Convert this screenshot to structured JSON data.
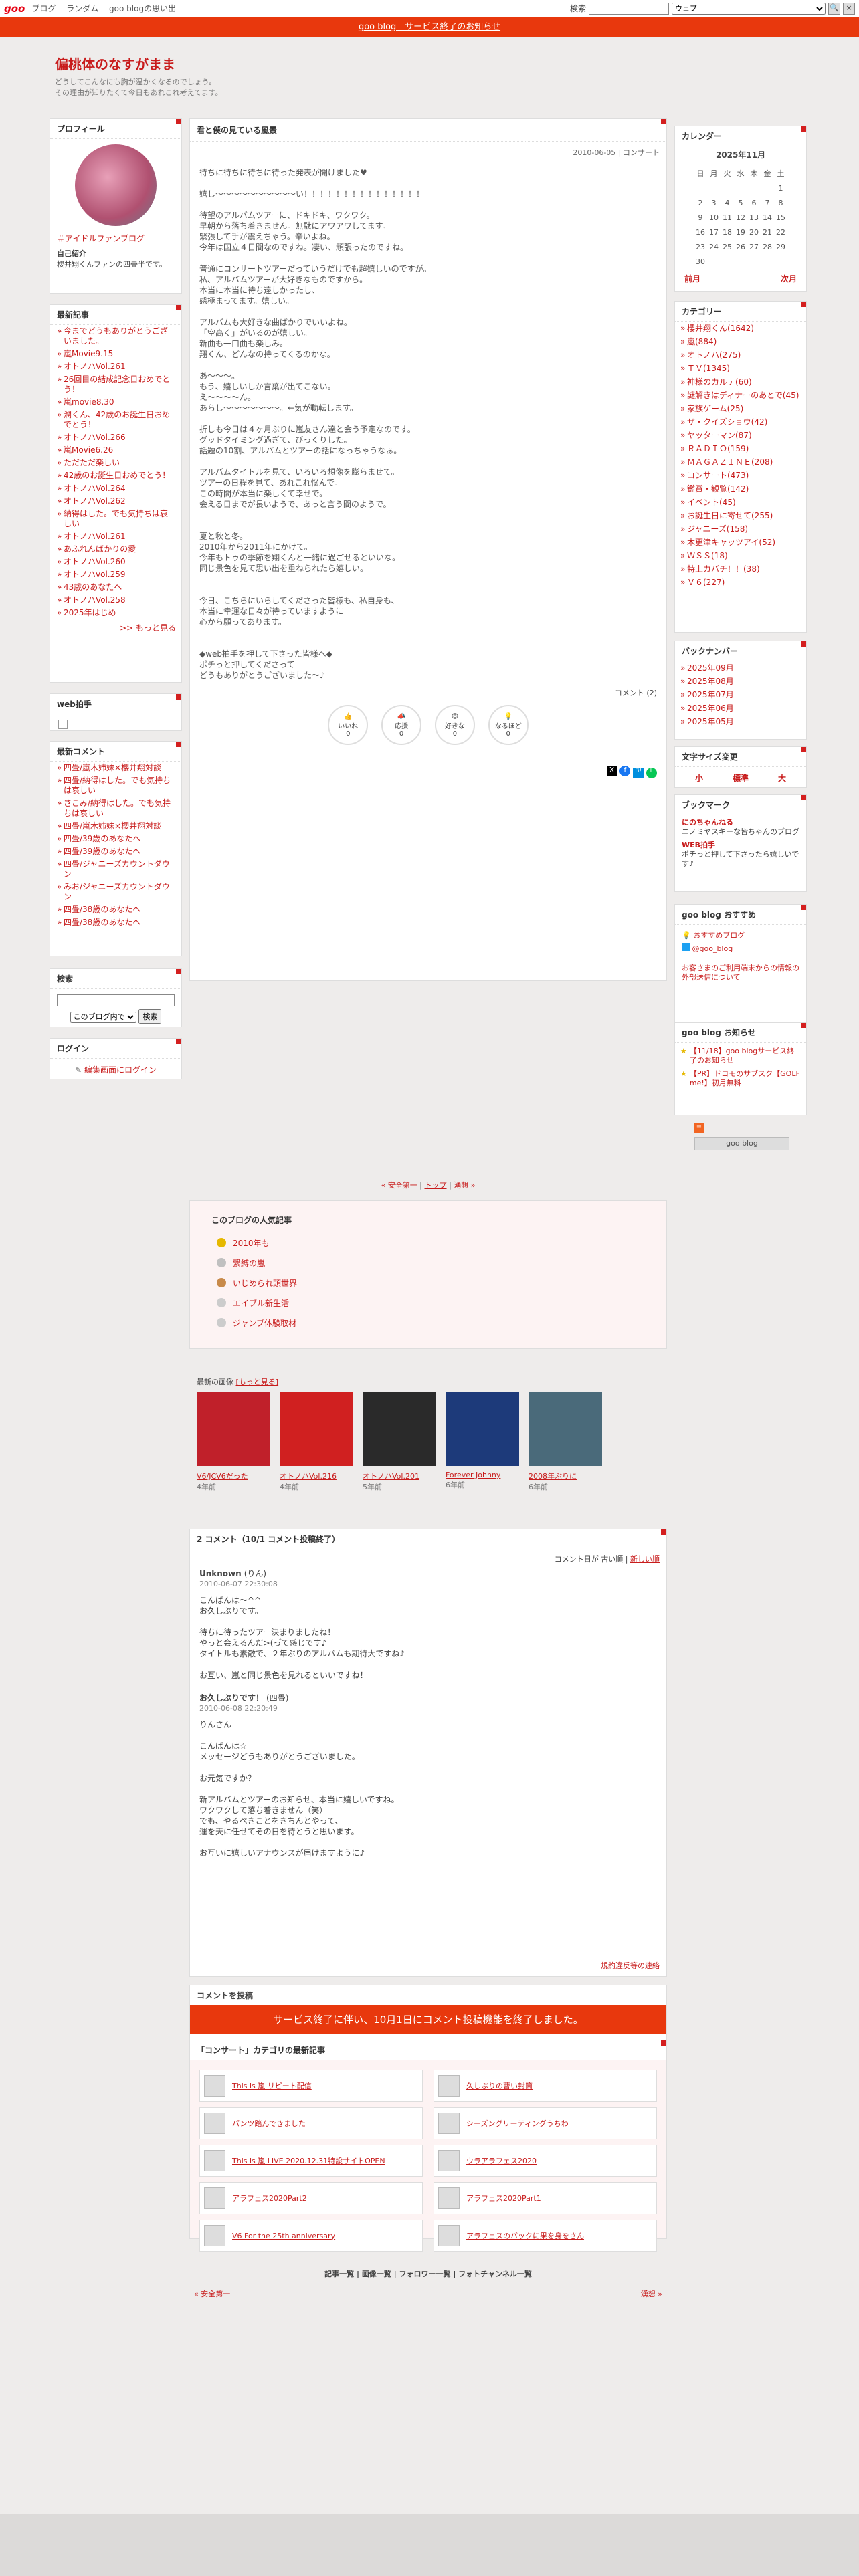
{
  "topbar": {
    "logo": "goo",
    "links": [
      "ブログ",
      "ランダム",
      "goo blogの思い出"
    ],
    "search_label": "検索",
    "search_scope": "ウェブ"
  },
  "banner": "goo blog　サービス終了のお知らせ",
  "header": {
    "title": "偏桃体のなすがまま",
    "desc1": "どうしてこんなにも胸が温かくなるのでしょう。",
    "desc2": "その理由が知りたくて今日もあれこれ考えてます。"
  },
  "profile": {
    "title": "プロフィール",
    "name": "＃アイドルファンブログ",
    "intro_label": "自己紹介",
    "intro": "櫻井翔くんファンの四畳半です。"
  },
  "recent": {
    "title": "最新記事",
    "items": [
      "今までどうもありがとうございました。",
      "嵐Movie9.15",
      "オトノハVol.261",
      "26回目の結成記念日おめでとう！",
      "嵐movie8.30",
      "潤くん、42歳のお誕生日おめでとう！",
      "オトノハVol.266",
      "嵐Movie6.26",
      "ただただ楽しい",
      "42歳のお誕生日おめでとう！",
      "オトノハVol.264",
      "オトノハVol.262",
      "納得はした。でも気持ちは哀しい",
      "オトノハVol.261",
      "あふれんばかりの愛",
      "オトノハVol.260",
      "オトノハvol.259",
      "43歳のあなたへ",
      "オトノハVol.258",
      "2025年はじめ"
    ],
    "more": ">> もっと見る"
  },
  "webclap": {
    "title": "web拍手"
  },
  "comments": {
    "title": "最新コメント",
    "items": [
      "四畳/嵐木姉妹×櫻井翔対談",
      "四畳/納得はした。でも気持ちは哀しい",
      "さこみ/納得はした。でも気持ちは哀しい",
      "四畳/嵐木姉妹×櫻井翔対談",
      "四畳/39歳のあなたへ",
      "四畳/39歳のあなたへ",
      "四畳/ジャニーズカウントダウン",
      "みお/ジャニーズカウントダウン",
      "四畳/38歳のあなたへ",
      "四畳/38歳のあなたへ"
    ]
  },
  "search": {
    "title": "検索",
    "scope": "このブログ内で",
    "button": "検索"
  },
  "login": {
    "title": "ログイン",
    "link": "編集画面にログイン"
  },
  "post": {
    "title": "君と僕の見ている風景",
    "meta": "2010-06-05 | コンサート",
    "body": [
      "待ちに待ちに待ちに待った発表が開けました♥",
      "",
      "嬉し〜〜〜〜〜〜〜〜〜〜い！！！！！！！！！！！！！！！",
      "",
      "待望のアルバムツアーに、ドキドキ、ワクワク。",
      "早朝から落ち着きません。無駄にアワアワしてます。",
      "緊張して手が震えちゃう。辛いよね。",
      "今年は国立４日間なのですね。凄い、頑張ったのですね。",
      "",
      "普通にコンサートツアーだっていうだけでも超嬉しいのですが。",
      "私、アルバムツアーが大好きなものですから。",
      "本当に本当に待ち遠しかったし、",
      "感極まってます。嬉しい。",
      "",
      "アルバムも大好きな曲ばかりでいいよね。",
      "「空高く」がいるのが嬉しい。",
      "新曲も一口曲も楽しみ。",
      "翔くん、どんなの持ってくるのかな。",
      "",
      "あ〜〜〜。",
      "もう、嬉しいしか言葉が出てこない。",
      "え〜〜〜〜ん。",
      "あらし〜〜〜〜〜〜〜。←気が動転します。",
      "",
      "折しも今日は４ヶ月ぶりに嵐友さん達と会う予定なのです。",
      "グッドタイミング過ぎて、びっくりした。",
      "話題の10割、アルバムとツアーの話になっちゃうなぁ。",
      "",
      "アルバムタイトルを見て、いろいろ想像を膨らませて。",
      "ツアーの日程を見て、あれこれ悩んで。",
      "この時間が本当に楽しくて幸せで。",
      "会える日までが長いようで、あっと言う間のようで。",
      "",
      "",
      "夏と秋と冬。",
      "2010年から2011年にかけて。",
      "今年もトゥの季節を翔くんと一緒に過ごせるといいな。",
      "同じ景色を見て思い出を重ねられたら嬉しい。",
      "",
      "",
      "今日、こちらにいらしてくださった皆様も、私自身も、",
      "本当に幸運な日々が待っていますように",
      "心から願ってあります。",
      "",
      "",
      "◆web拍手を押して下さった皆様へ◆",
      "ポチっと押してくださって",
      "どうもありがとうございました〜♪"
    ],
    "comment_count": "コメント (2)",
    "reactions": [
      {
        "label": "いいね",
        "count": "0"
      },
      {
        "label": "応援",
        "count": "0"
      },
      {
        "label": "好きな",
        "count": "0"
      },
      {
        "label": "なるほど",
        "count": "0"
      }
    ]
  },
  "calendar": {
    "title": "カレンダー",
    "month": "2025年11月",
    "days": [
      "日",
      "月",
      "火",
      "水",
      "木",
      "金",
      "土"
    ],
    "weeks": [
      [
        "",
        "",
        "",
        "",
        "",
        "",
        "1"
      ],
      [
        "2",
        "3",
        "4",
        "5",
        "6",
        "7",
        "8"
      ],
      [
        "9",
        "10",
        "11",
        "12",
        "13",
        "14",
        "15"
      ],
      [
        "16",
        "17",
        "18",
        "19",
        "20",
        "21",
        "22"
      ],
      [
        "23",
        "24",
        "25",
        "26",
        "27",
        "28",
        "29"
      ],
      [
        "30",
        "",
        "",
        "",
        "",
        "",
        ""
      ]
    ],
    "prev": "前月",
    "next": "次月"
  },
  "categories": {
    "title": "カテゴリー",
    "items": [
      "櫻井翔くん(1642)",
      "嵐(884)",
      "オトノハ(275)",
      "ＴＶ(1345)",
      "神様のカルテ(60)",
      "謎解きはディナーのあとで(45)",
      "家族ゲーム(25)",
      "ザ・クイズショウ(42)",
      "ヤッターマン(87)",
      "ＲＡＤＩＯ(159)",
      "ＭＡＧＡＺＩＮＥ(208)",
      "コンサート(473)",
      "鑑賞・観覧(142)",
      "イベント(45)",
      "お誕生日に寄せて(255)",
      "ジャニーズ(158)",
      "木更津キャッツアイ(52)",
      "ＷＳＳ(18)",
      "特上カバチ！！(38)",
      "Ｖ６(227)"
    ]
  },
  "backnumber": {
    "title": "バックナンバー",
    "items": [
      "2025年09月",
      "2025年08月",
      "2025年07月",
      "2025年06月",
      "2025年05月"
    ]
  },
  "fontsize": {
    "title": "文字サイズ変更",
    "small": "小",
    "mid": "標準",
    "large": "大"
  },
  "bookmark": {
    "title": "ブックマーク",
    "items": [
      {
        "name": "にのちゃんねる",
        "desc": "ニノミヤスキーな皆ちゃんのブログ"
      },
      {
        "name": "WEB拍手",
        "desc": "ポチっと押して下さったら嬉しいです♪"
      }
    ]
  },
  "recommend": {
    "title": "goo blog おすすめ",
    "items": [
      "おすすめブログ",
      "@goo_blog"
    ],
    "notice": "お客さまのご利用端末からの情報の外部送信について"
  },
  "announce": {
    "title": "goo blog お知らせ",
    "items": [
      "【11/18】goo blogサービス終了のお知らせ",
      "【PR】ドコモのサブスク【GOLF me!】初月無料"
    ]
  },
  "goo_blog_badge": "goo blog",
  "pager": {
    "prev": "« 安全第一",
    "top": "トップ",
    "next": "湧想 »"
  },
  "popular": {
    "title": "このブログの人気記事",
    "items": [
      "2010年も",
      "繋縛の嵐",
      "いじめられ頭世界一",
      "エイブル新生活",
      "ジャンプ体験取材"
    ]
  },
  "images": {
    "title": "最新の画像",
    "more": "[もっと見る]",
    "items": [
      {
        "title": "V6/JCV6だった",
        "age": "4年前",
        "color": "#c0202a"
      },
      {
        "title": "オトノハVol.216",
        "age": "4年前",
        "color": "#d02020"
      },
      {
        "title": "オトノハVol.201",
        "age": "5年前",
        "color": "#2a2a2a"
      },
      {
        "title": "Forever Johnny",
        "age": "6年前",
        "color": "#1d3a7a"
      },
      {
        "title": "2008年ぶりに",
        "age": "6年前",
        "color": "#4a6a7a"
      }
    ]
  },
  "comment_section": {
    "title": "2 コメント（10/1 コメント投稿終了）",
    "sort": "コメント日が 古い順 |",
    "new": "新しい順",
    "entries": [
      {
        "author": "Unknown",
        "who": "(りん)",
        "date": "2010-06-07 22:30:08",
        "lines": [
          "こんばんは〜^^",
          "お久しぶりです。",
          "",
          "待ちに待ったツアー決まりましたね！",
          "やっと会えるんだ>(っ゚て感じです♪",
          "タイトルも素敵で、２年ぶりのアルバムも期待大ですね♪",
          "",
          "お互い、嵐と同じ景色を見れるといいですね！"
        ]
      },
      {
        "author": "お久しぶりです！",
        "who": "(四畳)",
        "date": "2010-06-08 22:20:49",
        "lines": [
          "りんさん",
          "",
          "こんばんは☆",
          "メッセージどうもありがとうございました。",
          "",
          "お元気ですか？",
          "",
          "新アルバムとツアーのお知らせ、本当に嬉しいですね。",
          "ワクワクして落ち着きません（笑）",
          "でも、やるべきことをきちんとやって、",
          "運を天に任せてその日を待とうと思います。",
          "",
          "お互いに嬉しいアナウンスが届けますように♪"
        ]
      }
    ],
    "report": "規約違反等の連絡"
  },
  "comment_post": {
    "title": "コメントを投稿",
    "closed": "サービス終了に伴い、10月1日にコメント投稿機能を終了しました。"
  },
  "category_latest": {
    "title": "「コンサート」カテゴリの最新記事",
    "items": [
      "This is 嵐 リピート配信",
      "久しぶりの曹い封筒",
      "パンツ踏んできました",
      "シーズングリーティングうちわ",
      "This is 嵐 LIVE 2020.12.31特設サイトOPEN",
      "ウラアラフェス2020",
      "アラフェス2020Part2",
      "アラフェス2020Part1",
      "V6 For the 25th anniversary",
      "アラフェスのバックに果を身をさん"
    ]
  },
  "footer_links": {
    "a": "記事一覧",
    "b": "画像一覧",
    "c": "フォロワー一覧",
    "d": "フォトチャンネル一覧"
  }
}
